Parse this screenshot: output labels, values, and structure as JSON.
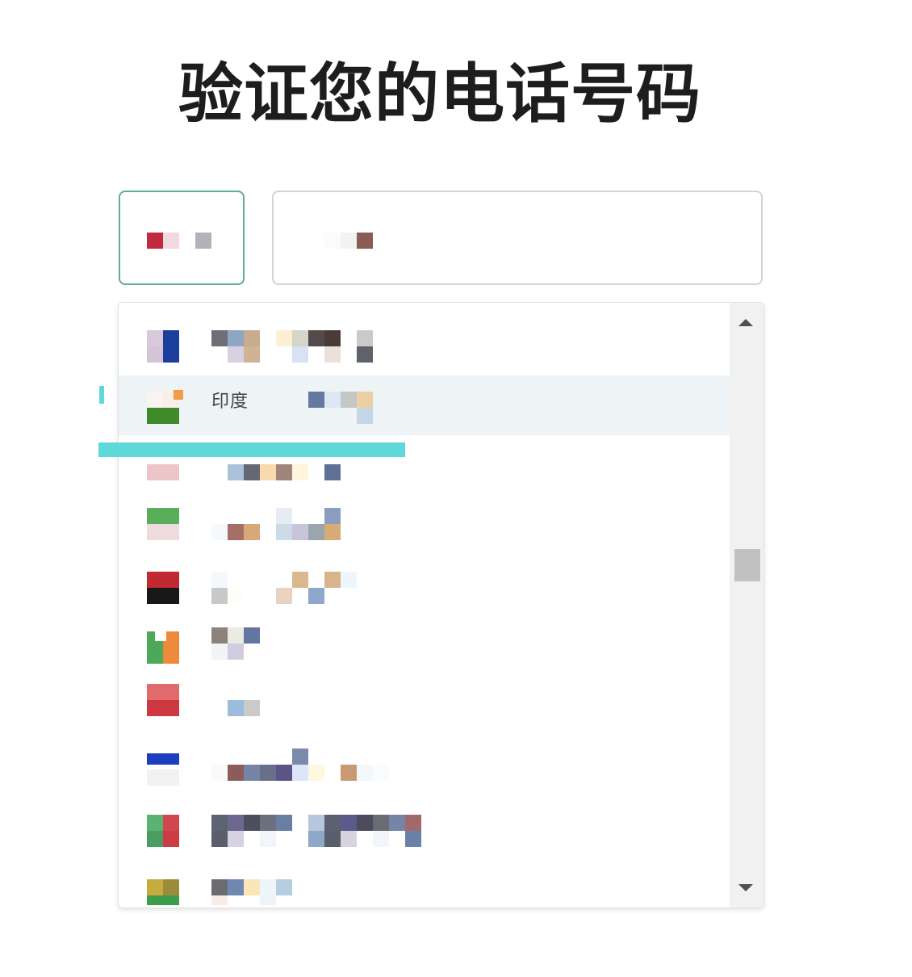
{
  "page": {
    "title": "验证您的电话号码"
  },
  "colors": {
    "country_border": "#5fae8d",
    "input_border": "#d2d2dc",
    "highlight_bg": "#eef4f6",
    "scroll_track": "#f1f1f1",
    "scroll_thumb": "#c1c1c1",
    "accent_cyan": "#5fd8da"
  },
  "country_select": {
    "flag_icon": "flag-icon",
    "chevron_icon": "chevron-down-icon"
  },
  "phone_input": {
    "value": ""
  },
  "dropdown": {
    "highlighted_label": "印度",
    "options": [
      {
        "flag_colors": [
          "#d9c8dc",
          "#1c3e9c",
          "#d4c4d6",
          "#1c3e9c"
        ]
      },
      {
        "flag_colors": [
          "#fbf3ee",
          "#f09a4a",
          "#3f8a2b",
          "#3f8a2b"
        ],
        "label": "印度"
      },
      {
        "flag_colors": [
          "#ffffff",
          "#ffffff",
          "#ecc5c8",
          "#ecc5c8"
        ]
      },
      {
        "flag_colors": [
          "#58ae5a",
          "#58ae5a",
          "#eddbde",
          "#eddbde"
        ]
      },
      {
        "flag_colors": [
          "#c02a30",
          "#c02a30",
          "#181818",
          "#181818"
        ]
      },
      {
        "flag_colors": [
          "#4da85a",
          "#ee8b3a",
          "#4da85a",
          "#ee8b3a"
        ]
      },
      {
        "flag_colors": [
          "#e06a6d",
          "#e06a6d",
          "#cd3940",
          "#cd3940"
        ]
      },
      {
        "flag_colors": [
          "#1d3ebf",
          "#1d3ebf",
          "#f1f1f1",
          "#f1f1f1"
        ]
      },
      {
        "flag_colors": [
          "#5bb373",
          "#d0474e",
          "#4c9d62",
          "#cd3b45"
        ]
      },
      {
        "flag_colors": [
          "#c4ac3e",
          "#9a8c3a",
          "#3c9e48",
          "#3c9e48"
        ]
      }
    ]
  },
  "scrollbar": {
    "up_icon": "scroll-up-arrow-icon",
    "down_icon": "scroll-down-arrow-icon"
  }
}
